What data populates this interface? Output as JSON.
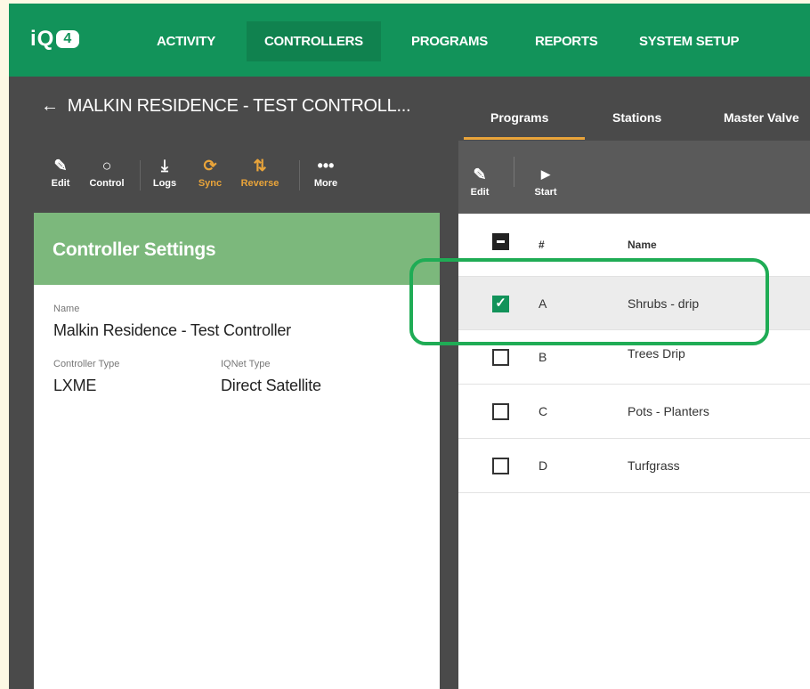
{
  "logo": {
    "text": "iQ",
    "badge": "4"
  },
  "nav": [
    "ACTIVITY",
    "CONTROLLERS",
    "PROGRAMS",
    "REPORTS",
    "SYSTEM SETUP"
  ],
  "nav_active": "CONTROLLERS",
  "header": {
    "back_icon": "←",
    "title": "MALKIN RESIDENCE - TEST CONTROLL..."
  },
  "left_toolbar": [
    {
      "label": "Edit",
      "icon": "pencil-icon",
      "glyph": "✎"
    },
    {
      "label": "Control",
      "icon": "circle-icon",
      "glyph": "○"
    },
    {
      "label": "Logs",
      "icon": "download-icon",
      "glyph": "⤓"
    },
    {
      "label": "Sync",
      "icon": "sync-icon",
      "glyph": "⟳"
    },
    {
      "label": "Reverse",
      "icon": "reverse-icon",
      "glyph": "⇅"
    },
    {
      "label": "More",
      "icon": "more-icon",
      "glyph": "•••"
    }
  ],
  "settings": {
    "title": "Controller Settings",
    "name_label": "Name",
    "name_value": "Malkin Residence - Test Controller",
    "type_label": "Controller Type",
    "type_value": "LXME",
    "iqnet_label": "IQNet Type",
    "iqnet_value": "Direct Satellite"
  },
  "tabs": [
    "Programs",
    "Stations",
    "Master Valve"
  ],
  "right_toolbar": [
    {
      "label": "Edit",
      "icon": "pencil-icon",
      "glyph": "✎"
    },
    {
      "label": "Start",
      "icon": "play-icon",
      "glyph": "▶"
    }
  ],
  "table": {
    "col_num": "#",
    "col_name": "Name",
    "rows": [
      {
        "num": "A",
        "name": "Shrubs - drip",
        "checked": true
      },
      {
        "num": "B",
        "name": "Trees Drip",
        "checked": false
      },
      {
        "num": "C",
        "name": "Pots - Planters",
        "checked": false
      },
      {
        "num": "D",
        "name": "Turfgrass",
        "checked": false
      }
    ]
  },
  "colors": {
    "brand_green": "#12935a",
    "card_header": "#7cb87c",
    "accent_orange": "#e9a43a",
    "highlight": "#1fac55"
  }
}
